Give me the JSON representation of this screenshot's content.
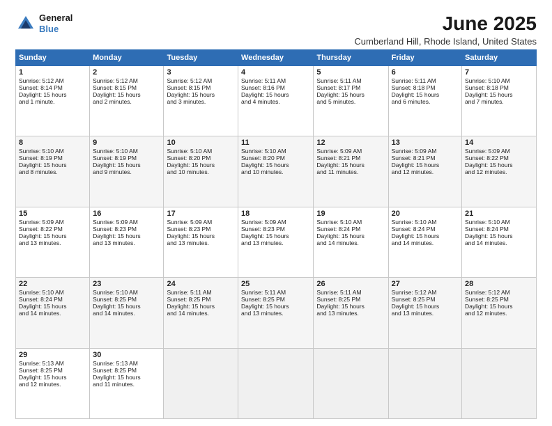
{
  "header": {
    "logo_line1": "General",
    "logo_line2": "Blue",
    "main_title": "June 2025",
    "subtitle": "Cumberland Hill, Rhode Island, United States"
  },
  "days_of_week": [
    "Sunday",
    "Monday",
    "Tuesday",
    "Wednesday",
    "Thursday",
    "Friday",
    "Saturday"
  ],
  "weeks": [
    [
      {
        "day": "1",
        "lines": [
          "Sunrise: 5:12 AM",
          "Sunset: 8:14 PM",
          "Daylight: 15 hours",
          "and 1 minute."
        ]
      },
      {
        "day": "2",
        "lines": [
          "Sunrise: 5:12 AM",
          "Sunset: 8:15 PM",
          "Daylight: 15 hours",
          "and 2 minutes."
        ]
      },
      {
        "day": "3",
        "lines": [
          "Sunrise: 5:12 AM",
          "Sunset: 8:15 PM",
          "Daylight: 15 hours",
          "and 3 minutes."
        ]
      },
      {
        "day": "4",
        "lines": [
          "Sunrise: 5:11 AM",
          "Sunset: 8:16 PM",
          "Daylight: 15 hours",
          "and 4 minutes."
        ]
      },
      {
        "day": "5",
        "lines": [
          "Sunrise: 5:11 AM",
          "Sunset: 8:17 PM",
          "Daylight: 15 hours",
          "and 5 minutes."
        ]
      },
      {
        "day": "6",
        "lines": [
          "Sunrise: 5:11 AM",
          "Sunset: 8:18 PM",
          "Daylight: 15 hours",
          "and 6 minutes."
        ]
      },
      {
        "day": "7",
        "lines": [
          "Sunrise: 5:10 AM",
          "Sunset: 8:18 PM",
          "Daylight: 15 hours",
          "and 7 minutes."
        ]
      }
    ],
    [
      {
        "day": "8",
        "lines": [
          "Sunrise: 5:10 AM",
          "Sunset: 8:19 PM",
          "Daylight: 15 hours",
          "and 8 minutes."
        ]
      },
      {
        "day": "9",
        "lines": [
          "Sunrise: 5:10 AM",
          "Sunset: 8:19 PM",
          "Daylight: 15 hours",
          "and 9 minutes."
        ]
      },
      {
        "day": "10",
        "lines": [
          "Sunrise: 5:10 AM",
          "Sunset: 8:20 PM",
          "Daylight: 15 hours",
          "and 10 minutes."
        ]
      },
      {
        "day": "11",
        "lines": [
          "Sunrise: 5:10 AM",
          "Sunset: 8:20 PM",
          "Daylight: 15 hours",
          "and 10 minutes."
        ]
      },
      {
        "day": "12",
        "lines": [
          "Sunrise: 5:09 AM",
          "Sunset: 8:21 PM",
          "Daylight: 15 hours",
          "and 11 minutes."
        ]
      },
      {
        "day": "13",
        "lines": [
          "Sunrise: 5:09 AM",
          "Sunset: 8:21 PM",
          "Daylight: 15 hours",
          "and 12 minutes."
        ]
      },
      {
        "day": "14",
        "lines": [
          "Sunrise: 5:09 AM",
          "Sunset: 8:22 PM",
          "Daylight: 15 hours",
          "and 12 minutes."
        ]
      }
    ],
    [
      {
        "day": "15",
        "lines": [
          "Sunrise: 5:09 AM",
          "Sunset: 8:22 PM",
          "Daylight: 15 hours",
          "and 13 minutes."
        ]
      },
      {
        "day": "16",
        "lines": [
          "Sunrise: 5:09 AM",
          "Sunset: 8:23 PM",
          "Daylight: 15 hours",
          "and 13 minutes."
        ]
      },
      {
        "day": "17",
        "lines": [
          "Sunrise: 5:09 AM",
          "Sunset: 8:23 PM",
          "Daylight: 15 hours",
          "and 13 minutes."
        ]
      },
      {
        "day": "18",
        "lines": [
          "Sunrise: 5:09 AM",
          "Sunset: 8:23 PM",
          "Daylight: 15 hours",
          "and 13 minutes."
        ]
      },
      {
        "day": "19",
        "lines": [
          "Sunrise: 5:10 AM",
          "Sunset: 8:24 PM",
          "Daylight: 15 hours",
          "and 14 minutes."
        ]
      },
      {
        "day": "20",
        "lines": [
          "Sunrise: 5:10 AM",
          "Sunset: 8:24 PM",
          "Daylight: 15 hours",
          "and 14 minutes."
        ]
      },
      {
        "day": "21",
        "lines": [
          "Sunrise: 5:10 AM",
          "Sunset: 8:24 PM",
          "Daylight: 15 hours",
          "and 14 minutes."
        ]
      }
    ],
    [
      {
        "day": "22",
        "lines": [
          "Sunrise: 5:10 AM",
          "Sunset: 8:24 PM",
          "Daylight: 15 hours",
          "and 14 minutes."
        ]
      },
      {
        "day": "23",
        "lines": [
          "Sunrise: 5:10 AM",
          "Sunset: 8:25 PM",
          "Daylight: 15 hours",
          "and 14 minutes."
        ]
      },
      {
        "day": "24",
        "lines": [
          "Sunrise: 5:11 AM",
          "Sunset: 8:25 PM",
          "Daylight: 15 hours",
          "and 14 minutes."
        ]
      },
      {
        "day": "25",
        "lines": [
          "Sunrise: 5:11 AM",
          "Sunset: 8:25 PM",
          "Daylight: 15 hours",
          "and 13 minutes."
        ]
      },
      {
        "day": "26",
        "lines": [
          "Sunrise: 5:11 AM",
          "Sunset: 8:25 PM",
          "Daylight: 15 hours",
          "and 13 minutes."
        ]
      },
      {
        "day": "27",
        "lines": [
          "Sunrise: 5:12 AM",
          "Sunset: 8:25 PM",
          "Daylight: 15 hours",
          "and 13 minutes."
        ]
      },
      {
        "day": "28",
        "lines": [
          "Sunrise: 5:12 AM",
          "Sunset: 8:25 PM",
          "Daylight: 15 hours",
          "and 12 minutes."
        ]
      }
    ],
    [
      {
        "day": "29",
        "lines": [
          "Sunrise: 5:13 AM",
          "Sunset: 8:25 PM",
          "Daylight: 15 hours",
          "and 12 minutes."
        ]
      },
      {
        "day": "30",
        "lines": [
          "Sunrise: 5:13 AM",
          "Sunset: 8:25 PM",
          "Daylight: 15 hours",
          "and 11 minutes."
        ]
      },
      {
        "day": "",
        "lines": []
      },
      {
        "day": "",
        "lines": []
      },
      {
        "day": "",
        "lines": []
      },
      {
        "day": "",
        "lines": []
      },
      {
        "day": "",
        "lines": []
      }
    ]
  ]
}
